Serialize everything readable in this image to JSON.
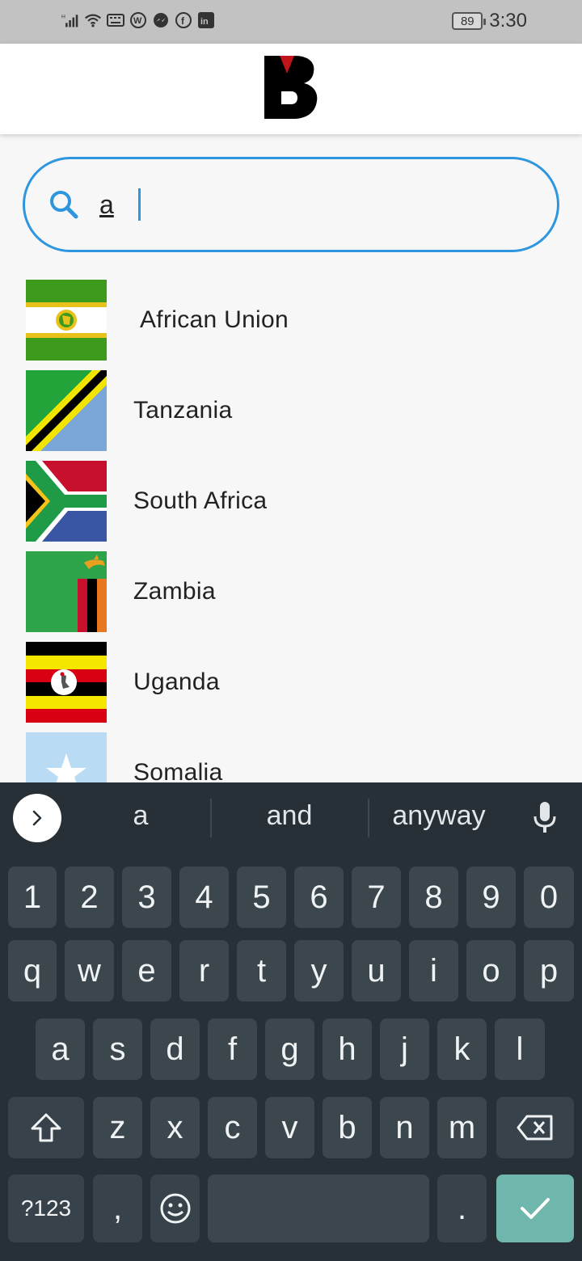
{
  "status": {
    "time": "3:30",
    "battery": "89",
    "icons": [
      "signal-icon",
      "wifi-icon",
      "keyboard-icon",
      "w-app-icon",
      "messenger-icon",
      "facebook-icon",
      "linkedin-icon"
    ]
  },
  "app": {
    "logo_letter": "B",
    "logo_colors": {
      "letter": "#000000",
      "accent": "#c0141a"
    }
  },
  "search": {
    "value": "a",
    "icon": "search-icon",
    "accent": "#2e96df"
  },
  "countries": [
    {
      "name": "African Union",
      "flag": "african-union-flag"
    },
    {
      "name": "Tanzania",
      "flag": "tanzania-flag"
    },
    {
      "name": "South Africa",
      "flag": "south-africa-flag"
    },
    {
      "name": "Zambia",
      "flag": "zambia-flag"
    },
    {
      "name": "Uganda",
      "flag": "uganda-flag"
    },
    {
      "name": "Somalia",
      "flag": "somalia-flag"
    }
  ],
  "keyboard": {
    "suggestions": [
      "a",
      "and",
      "anyway"
    ],
    "row_numbers": [
      "1",
      "2",
      "3",
      "4",
      "5",
      "6",
      "7",
      "8",
      "9",
      "0"
    ],
    "row_top": [
      "q",
      "w",
      "e",
      "r",
      "t",
      "y",
      "u",
      "i",
      "o",
      "p"
    ],
    "row_middle": [
      "a",
      "s",
      "d",
      "f",
      "g",
      "h",
      "j",
      "k",
      "l"
    ],
    "row_bottom": [
      "z",
      "x",
      "c",
      "v",
      "b",
      "n",
      "m"
    ],
    "symbols_label": "?123",
    "comma": ",",
    "period": ".",
    "colors": {
      "background": "#263036",
      "key": "#3b464d",
      "enter": "#6fb6ad"
    }
  }
}
